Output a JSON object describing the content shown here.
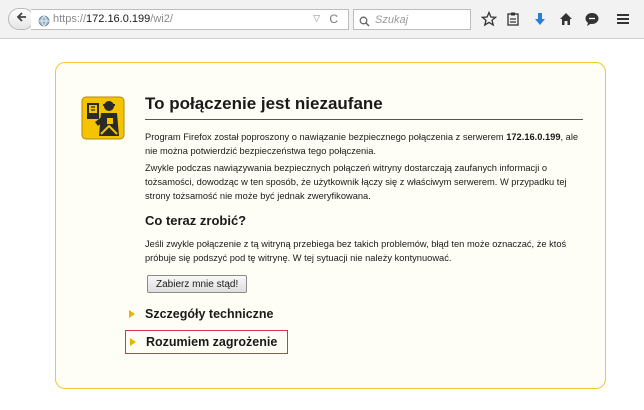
{
  "toolbar": {
    "url_prefix": "https://",
    "url_host": "172.16.0.199",
    "url_path": "/wi2/",
    "search_placeholder": "Szukaj"
  },
  "error": {
    "title": "To połączenie jest niezaufane",
    "p1_before": "Program Firefox został poproszony o nawiązanie bezpiecznego połączenia z serwerem ",
    "p1_host": "172.16.0.199",
    "p1_after": ", ale nie można potwierdzić bezpieczeństwa tego połączenia.",
    "p2": "Zwykle podczas nawiązywania bezpiecznych połączeń witryny dostarczają zaufanych informacji o tożsamości, dowodząc w ten sposób, że użytkownik łączy się z właściwym serwerem. W przypadku tej strony tożsamość nie może być jednak zweryfikowana.",
    "subtitle": "Co teraz zrobić?",
    "p3": "Jeśli zwykle połączenie z tą witryną przebiega bez takich problemów, błąd ten może oznaczać, że ktoś próbuje się podszyć pod tę witrynę. W tej sytuacji nie należy kontynuować.",
    "button_label": "Zabierz mnie stąd!",
    "expander_technical": "Szczegóły techniczne",
    "expander_risk": "Rozumiem zagrożenie"
  },
  "icons": {
    "back": "back-arrow-icon",
    "globe": "globe-icon",
    "reload": "reload-icon",
    "search": "search-icon",
    "bookmark_star": "star-icon",
    "reading_list": "clipboard-icon",
    "downloads": "download-arrow-icon",
    "home": "home-icon",
    "chat": "chat-bubble-icon",
    "menu": "hamburger-menu-icon",
    "certificate_warning": "certificate-officer-icon"
  },
  "colors": {
    "panel_border": "#f0c830",
    "expander_triangle": "#e8b400",
    "highlight_border": "#e0304c",
    "download_blue": "#2a7fd4"
  }
}
